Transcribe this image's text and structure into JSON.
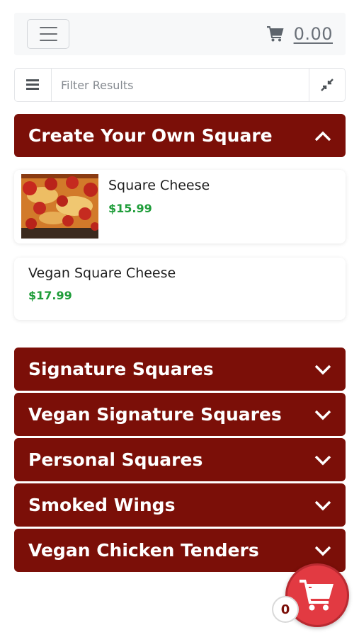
{
  "header": {
    "cart_total": "0.00"
  },
  "filter": {
    "placeholder": "Filter Results"
  },
  "menu": {
    "expanded_category": {
      "title": "Create Your Own Square",
      "items": [
        {
          "name": "Square Cheese",
          "price": "$15.99",
          "has_image": true
        },
        {
          "name": "Vegan Square Cheese",
          "price": "$17.99",
          "has_image": false
        }
      ]
    },
    "collapsed_categories": [
      "Signature Squares",
      "Vegan Signature Squares",
      "Personal Squares",
      "Smoked Wings",
      "Vegan Chicken Tenders"
    ]
  },
  "floating_cart": {
    "count": "0"
  },
  "colors": {
    "category_bg": "#7b0f08",
    "price_green": "#1f9d3a",
    "fab_red": "#e23a42"
  },
  "icons": [
    "hamburger-icon",
    "cart-icon",
    "list-icon",
    "compress-icon",
    "chevron-up-icon",
    "chevron-down-icon"
  ]
}
